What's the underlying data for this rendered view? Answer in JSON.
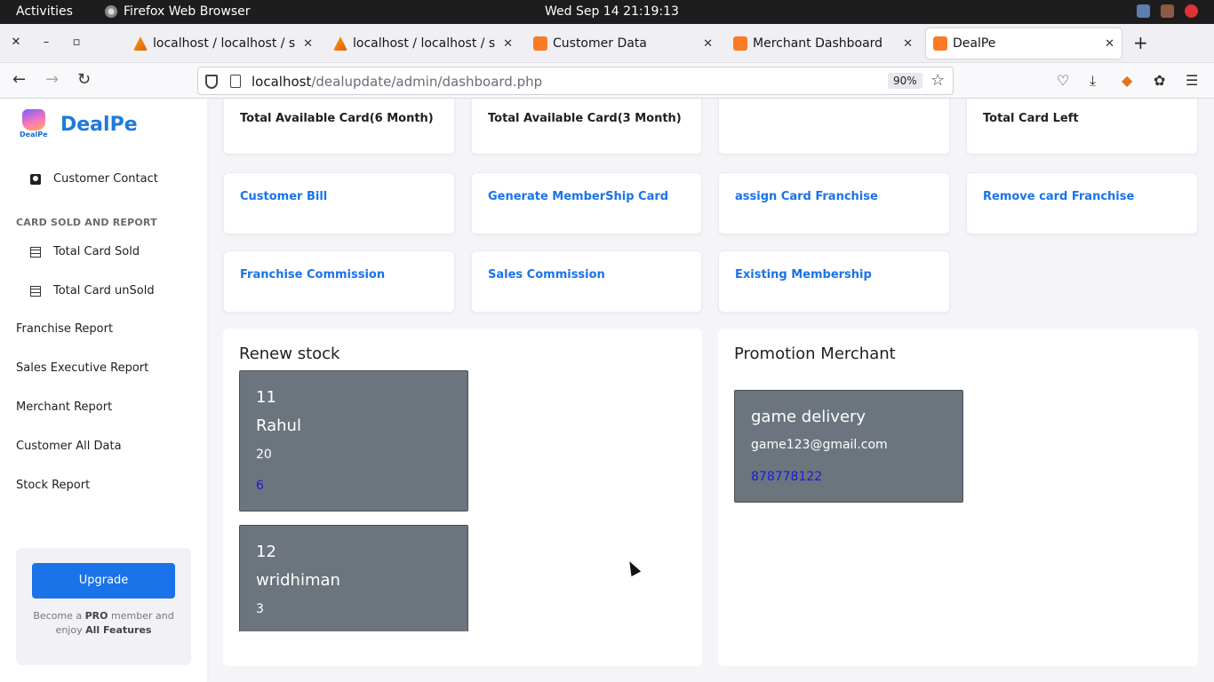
{
  "system": {
    "activities": "Activities",
    "app_name": "Firefox Web Browser",
    "clock": "Wed Sep 14  21:19:13"
  },
  "tabs": [
    {
      "title": "localhost / localhost / sig",
      "icon": "phpmyadmin-icon"
    },
    {
      "title": "localhost / localhost / sig",
      "icon": "phpmyadmin-icon"
    },
    {
      "title": "Customer Data",
      "icon": "xampp-icon"
    },
    {
      "title": "Merchant Dashboard",
      "icon": "xampp-icon"
    },
    {
      "title": "DealPe",
      "icon": "xampp-icon",
      "active": true
    }
  ],
  "urlbar": {
    "host": "localhost",
    "path": "/dealupdate/admin/dashboard.php",
    "zoom": "90%"
  },
  "sidebar": {
    "brand": "DealPe",
    "logo_text": "DealPe",
    "customer_contact": "Customer Contact",
    "section_heading": "CARD SOLD AND REPORT",
    "total_card_sold": "Total Card Sold",
    "total_card_unsold": "Total Card unSold",
    "items": [
      "Franchise Report",
      "Sales Executive Report",
      "Merchant Report",
      "Customer All Data",
      "Stock Report"
    ],
    "upgrade_button": "Upgrade",
    "upgrade_text_1": "Become a ",
    "upgrade_text_pro": "PRO",
    "upgrade_text_2": " member and enjoy ",
    "upgrade_text_all": "All Features"
  },
  "stat_cards": [
    "Total Available Card(6 Month)",
    "Total Available Card(3 Month)",
    "",
    "Total Card Left"
  ],
  "link_cards_row1": [
    "Customer Bill",
    "Generate MemberShip Card",
    "assign Card Franchise",
    "Remove card Franchise"
  ],
  "link_cards_row2": [
    "Franchise Commission",
    "Sales Commission",
    "Existing Membership"
  ],
  "renew_stock": {
    "title": "Renew stock",
    "items": [
      {
        "id": "11",
        "name": "Rahul",
        "qty": "20",
        "link": "6"
      },
      {
        "id": "12",
        "name": "wridhiman",
        "qty": "3"
      }
    ]
  },
  "promotion_merchant": {
    "title": "Promotion Merchant",
    "name": "game delivery",
    "email": "game123@gmail.com",
    "phone": "878778122"
  },
  "colors": {
    "brand_blue": "#1e7ad9",
    "link_blue": "#1a73e8",
    "card_gray": "#6c757d"
  }
}
